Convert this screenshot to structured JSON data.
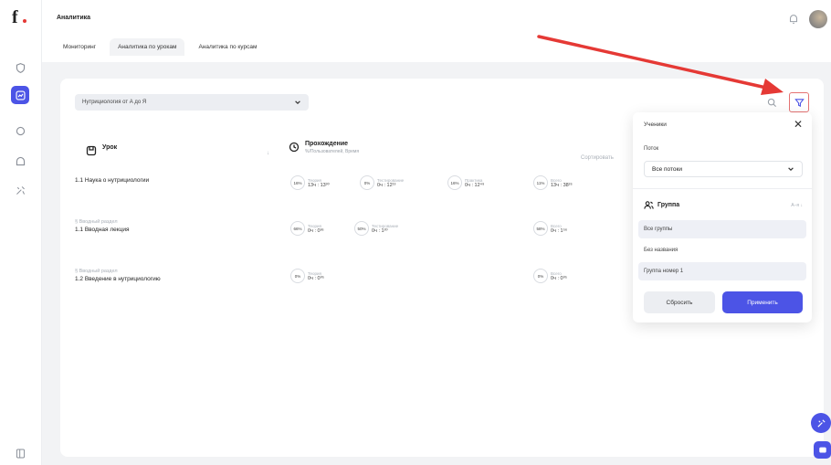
{
  "sidebar": {
    "icons": [
      "logo",
      "shield-icon",
      "analytics-icon",
      "circle-icon",
      "home-icon",
      "tools-icon",
      "panel-icon"
    ]
  },
  "header": {
    "title": "Аналитика",
    "tabs": [
      {
        "label": "Мониторинг"
      },
      {
        "label": "Аналитика по урокам"
      },
      {
        "label": "Аналитика по курсам"
      }
    ]
  },
  "toolbar": {
    "sort_value": "Нутрициология от А до Я"
  },
  "table": {
    "col_lesson": "Урок",
    "col_progress_title": "Прохождение",
    "col_progress_sub": "%/Пользователей, Время",
    "sort_label": "Сортировать"
  },
  "rows": [
    {
      "section": "",
      "lesson": "1.1 Наука о нутрициологии",
      "stats": [
        {
          "pct": "16%",
          "label": "Теория",
          "value": "13ч : 13³⁰"
        },
        {
          "pct": "0%",
          "label": "Тестирование",
          "value": "0ч : 12¹³"
        },
        {
          "pct": "16%",
          "label": "Практика",
          "value": "0ч : 12⁴⁹"
        },
        {
          "pct": "11%",
          "label": "Всего",
          "value": "13ч : 38²⁶"
        }
      ]
    },
    {
      "section": "§ Вводный раздел",
      "lesson": "1.1 Вводная лекция",
      "stats": [
        {
          "pct": "66%",
          "label": "Теория",
          "value": "0ч : 0³⁶"
        },
        {
          "pct": "50%",
          "label": "Тестирование",
          "value": "0ч : 1²⁰"
        },
        {
          "pct": "58%",
          "label": "Всего",
          "value": "0ч : 1⁵⁶"
        }
      ]
    },
    {
      "section": "§ Вводный раздел",
      "lesson": "1.2 Введение в нутрициологию",
      "stats": [
        {
          "pct": "0%",
          "label": "Теория",
          "value": "0ч : 0⁰⁵"
        },
        {
          "pct": "0%",
          "label": "Всего",
          "value": "0ч : 0⁰⁵"
        }
      ]
    }
  ],
  "filter_panel": {
    "title": "Ученики",
    "stream_label": "Поток",
    "stream_value": "Все потоки",
    "group_title": "Группа",
    "group_sort": "А–я ↓",
    "groups": [
      "Все группы",
      "Без названия",
      "Группа номер 1"
    ],
    "reset_label": "Сбросить",
    "apply_label": "Применить"
  },
  "colors": {
    "accent": "#4c54e6",
    "annotation_arrow": "#e53935"
  }
}
